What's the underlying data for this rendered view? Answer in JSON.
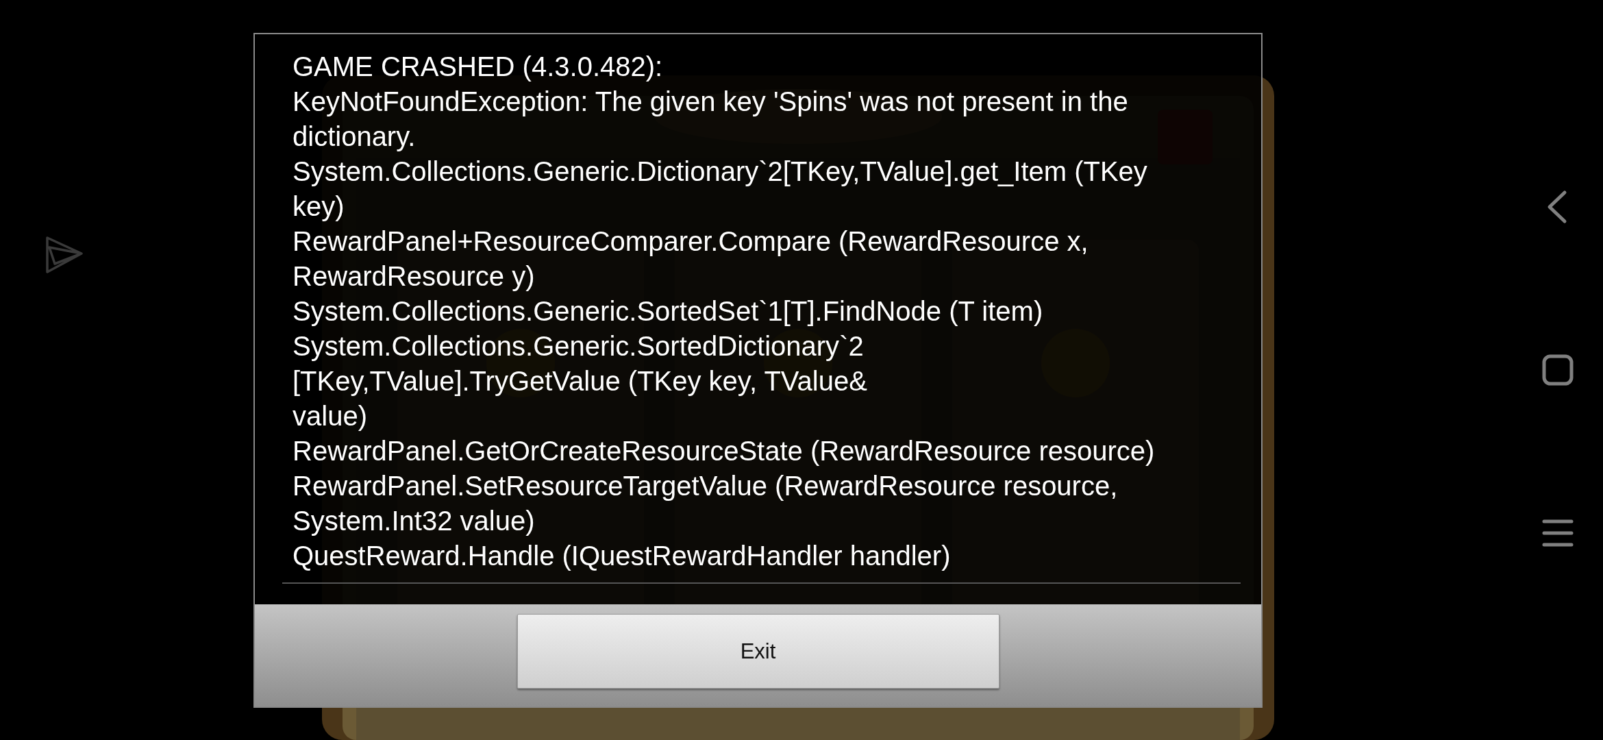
{
  "dialog": {
    "title": "GAME CRASHED (4.3.0.482):",
    "log": [
      "KeyNotFoundException: The given key 'Spins' was not present in the\ndictionary.",
      "System.Collections.Generic.Dictionary`2[TKey,TValue].get_Item (TKey\nkey)",
      "RewardPanel+ResourceComparer.Compare (RewardResource x,\nRewardResource y)",
      "System.Collections.Generic.SortedSet`1[T].FindNode (T item)",
      "System.Collections.Generic.SortedDictionary`2\n[TKey,TValue].TryGetValue (TKey key, TValue&\nvalue)",
      "RewardPanel.GetOrCreateResourceState (RewardResource resource)",
      "RewardPanel.SetResourceTargetValue (RewardResource resource,\nSystem.Int32 value)",
      "QuestReward.Handle (IQuestRewardHandler handler)"
    ],
    "button": "Exit"
  }
}
